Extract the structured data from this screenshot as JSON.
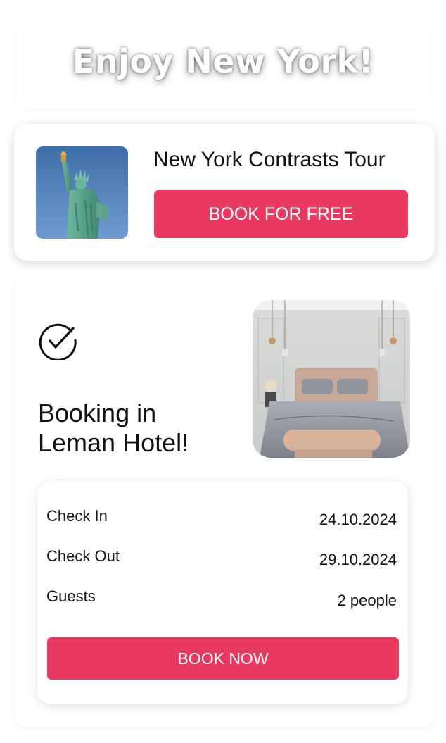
{
  "header": {
    "title": "Enjoy New York!"
  },
  "tour": {
    "title": "New York Contrasts Tour",
    "button_label": "BOOK FOR FREE",
    "image_subject": "statue-of-liberty"
  },
  "hotel": {
    "title_line1": "Booking in",
    "title_line2": "Leman Hotel!",
    "image_subject": "hotel-bedroom",
    "details": [
      {
        "label": "Check In",
        "value": "24.10.2024"
      },
      {
        "label": "Check Out",
        "value": "29.10.2024"
      },
      {
        "label": "Guests",
        "value": "2 people"
      }
    ],
    "button_label": "BOOK NOW"
  },
  "colors": {
    "accent": "#e83a60",
    "text": "#111111",
    "background": "#ffffff"
  },
  "icons": {
    "confirmation": "check-circle-icon"
  }
}
